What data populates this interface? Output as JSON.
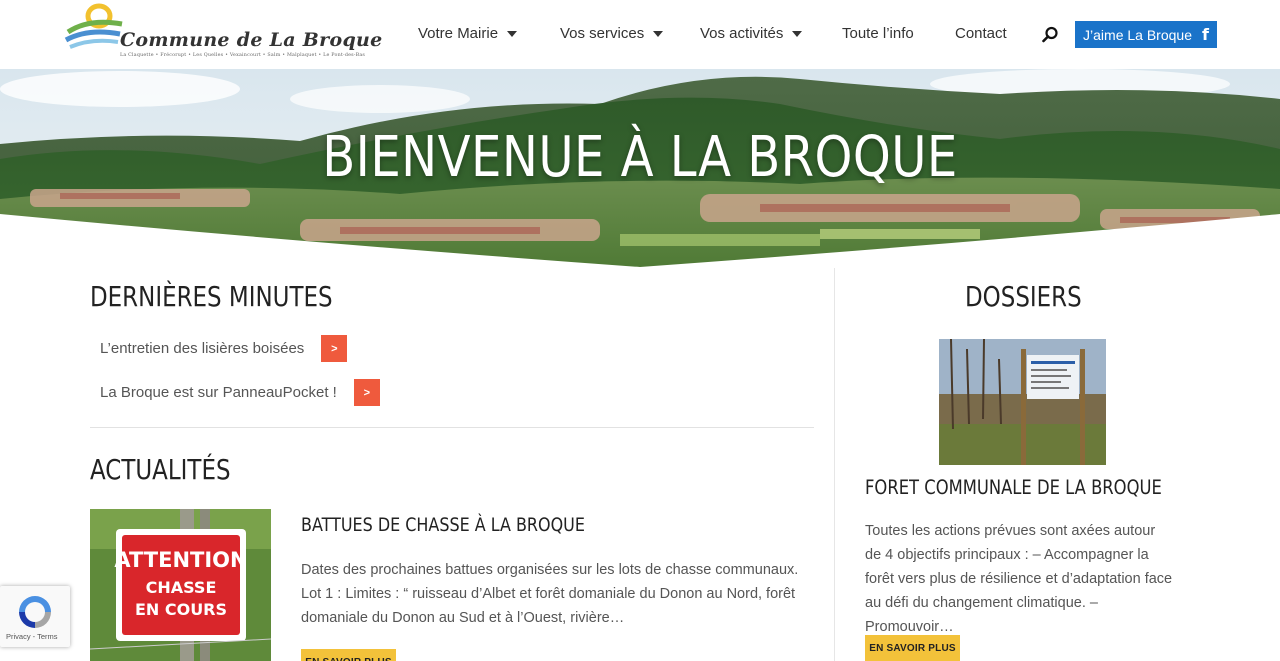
{
  "header": {
    "logo_text": "Commune de La Broque",
    "logo_subtitle": "La Claquette • Frécorupt • Les Quelles • Vexaincourt • Salm • Malplaquet • Le Pont-des-Bas",
    "nav": [
      {
        "label": "Votre Mairie",
        "has_dropdown": true
      },
      {
        "label": "Vos services",
        "has_dropdown": true
      },
      {
        "label": "Vos activités",
        "has_dropdown": true
      },
      {
        "label": "Toute l’info",
        "has_dropdown": false
      },
      {
        "label": "Contact",
        "has_dropdown": false
      }
    ],
    "search_icon": "search-icon",
    "fb_button_label": "J’aime La Broque",
    "fb_icon": "facebook-icon",
    "colors": {
      "fb_blue": "#1a73c9"
    }
  },
  "hero": {
    "title": "BIENVENUE À LA BROQUE"
  },
  "dernieres_minutes": {
    "title": "DERNIÈRES MINUTES",
    "items": [
      {
        "label": "L’entretien des lisières boisées",
        "arrow": ">"
      },
      {
        "label": "La Broque est sur PanneauPocket !",
        "arrow": ">"
      }
    ],
    "accent_color": "#ef5a3d"
  },
  "actualites": {
    "title": "ACTUALITÉS",
    "articles": [
      {
        "thumb_sign": {
          "line1": "ATTENTION",
          "line2": "CHASSE",
          "line3": "EN COURS"
        },
        "title": "BATTUES DE CHASSE À LA BROQUE",
        "excerpt": "Dates des prochaines battues organisées sur les lots de chasse communaux. Lot 1 : Limites : “ ruisseau d’Albet et forêt domaniale du Donon au Nord, forêt domaniale du Donon au Sud et à l’Ouest, rivière…",
        "more_label": "EN SAVOIR PLUS"
      }
    ]
  },
  "dossiers": {
    "title": "DOSSIERS",
    "item": {
      "title": "FORET COMMUNALE DE LA BROQUE",
      "excerpt": "Toutes les actions prévues sont axées autour de 4 objectifs principaux : – Accompagner la forêt vers plus de résilience et d’adaptation face au défi du changement climatique. – Promouvoir…",
      "more_label": "EN SAVOIR PLUS"
    },
    "button_color": "#f3c23a"
  },
  "recaptcha": {
    "links": "Privacy - Terms"
  }
}
